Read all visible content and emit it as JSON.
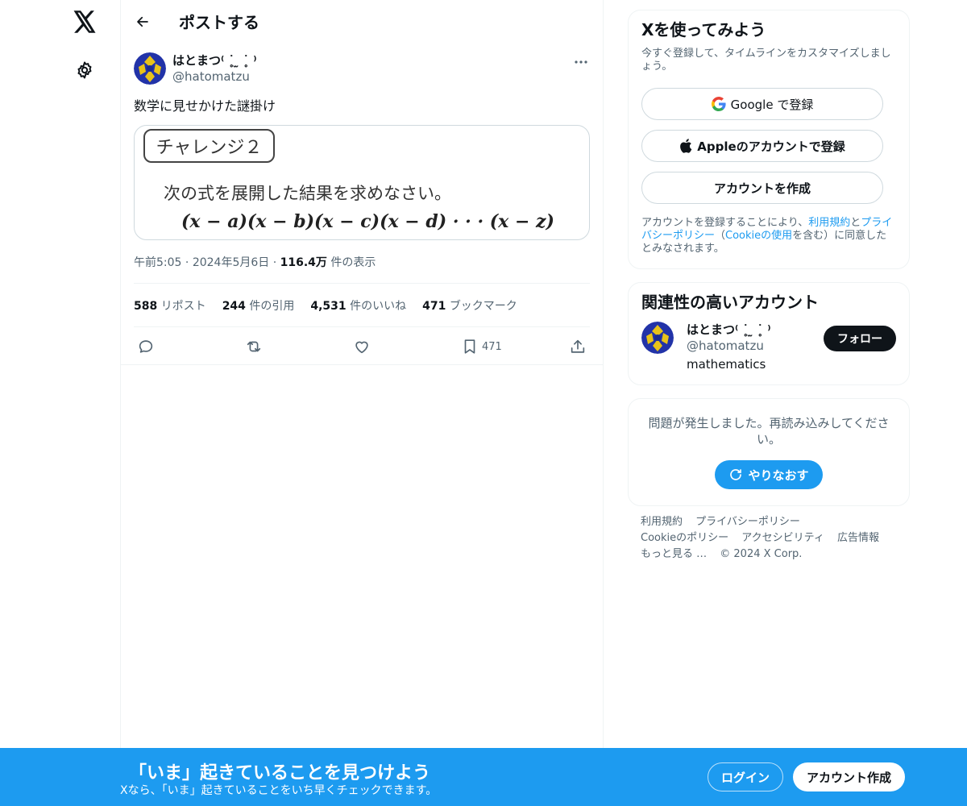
{
  "nav": {
    "logo_icon": "x-logo-icon",
    "settings_icon": "gear-icon"
  },
  "header": {
    "title": "ポストする"
  },
  "post": {
    "display_name": "はとまつ⁽ ˙̥̥̥ ̫ ˙̥̥̥ ⁾",
    "display_name_shown": "はとまつ⁽ ˙̥ ̫ ˙̥ ⁾",
    "handle": "@hatomatzu",
    "text": "数学に見せかけた謎掛け",
    "media": {
      "challenge_label": "チャレンジ２",
      "question": "次の式を展開した結果を求めなさい。",
      "expression": "(x − a)(x − b)(x − c)(x − d) · · · (x − z)"
    },
    "time": "午前5:05",
    "date": "2024年5月6日",
    "views_count": "116.4万",
    "views_label": "件の表示",
    "stats": {
      "reposts_count": "588",
      "reposts_label": "リポスト",
      "quotes_count": "244",
      "quotes_label": "件の引用",
      "likes_count": "4,531",
      "likes_label": "件のいいね",
      "bookmarks_count": "471",
      "bookmarks_label": "ブックマーク"
    },
    "actions": {
      "bookmark_count": "471"
    }
  },
  "signup_card": {
    "title": "Xを使ってみよう",
    "subtitle": "今すぐ登録して、タイムラインをカスタマイズしましょう。",
    "google_label": "Google で登録",
    "apple_label": "Appleのアカウントで登録",
    "create_label": "アカウントを作成",
    "terms_prefix": "アカウントを登録することにより、",
    "terms_link": "利用規約",
    "terms_and": "と",
    "privacy_link": "プライバシーポリシー",
    "cookie_open": "（",
    "cookie_link": "Cookieの使用",
    "cookie_close": "を含む）に同意したとみなされます。"
  },
  "related_card": {
    "title": "関連性の高いアカウント",
    "display_name": "はとまつ⁽ ˙̥ ̫ ˙̥ ⁾",
    "handle": "@hatomatzu",
    "bio": "mathematics",
    "follow_label": "フォロー"
  },
  "error_card": {
    "message": "問題が発生しました。再読み込みしてください。",
    "retry_label": "やりなおす"
  },
  "footer": {
    "terms": "利用規約",
    "privacy": "プライバシーポリシー",
    "cookie": "Cookieのポリシー",
    "accessibility": "アクセシビリティ",
    "ads": "広告情報",
    "more": "もっと見る …",
    "copyright": "© 2024 X Corp."
  },
  "banner": {
    "title": "「いま」起きていることを見つけよう",
    "subtitle": "Xなら、「いま」起きていることをいち早くチェックできます。",
    "login_label": "ログイン",
    "signup_label": "アカウント作成"
  },
  "colors": {
    "accent": "#1d9bf0",
    "text": "#0f1419",
    "muted": "#536471",
    "border": "#eff3f4"
  }
}
